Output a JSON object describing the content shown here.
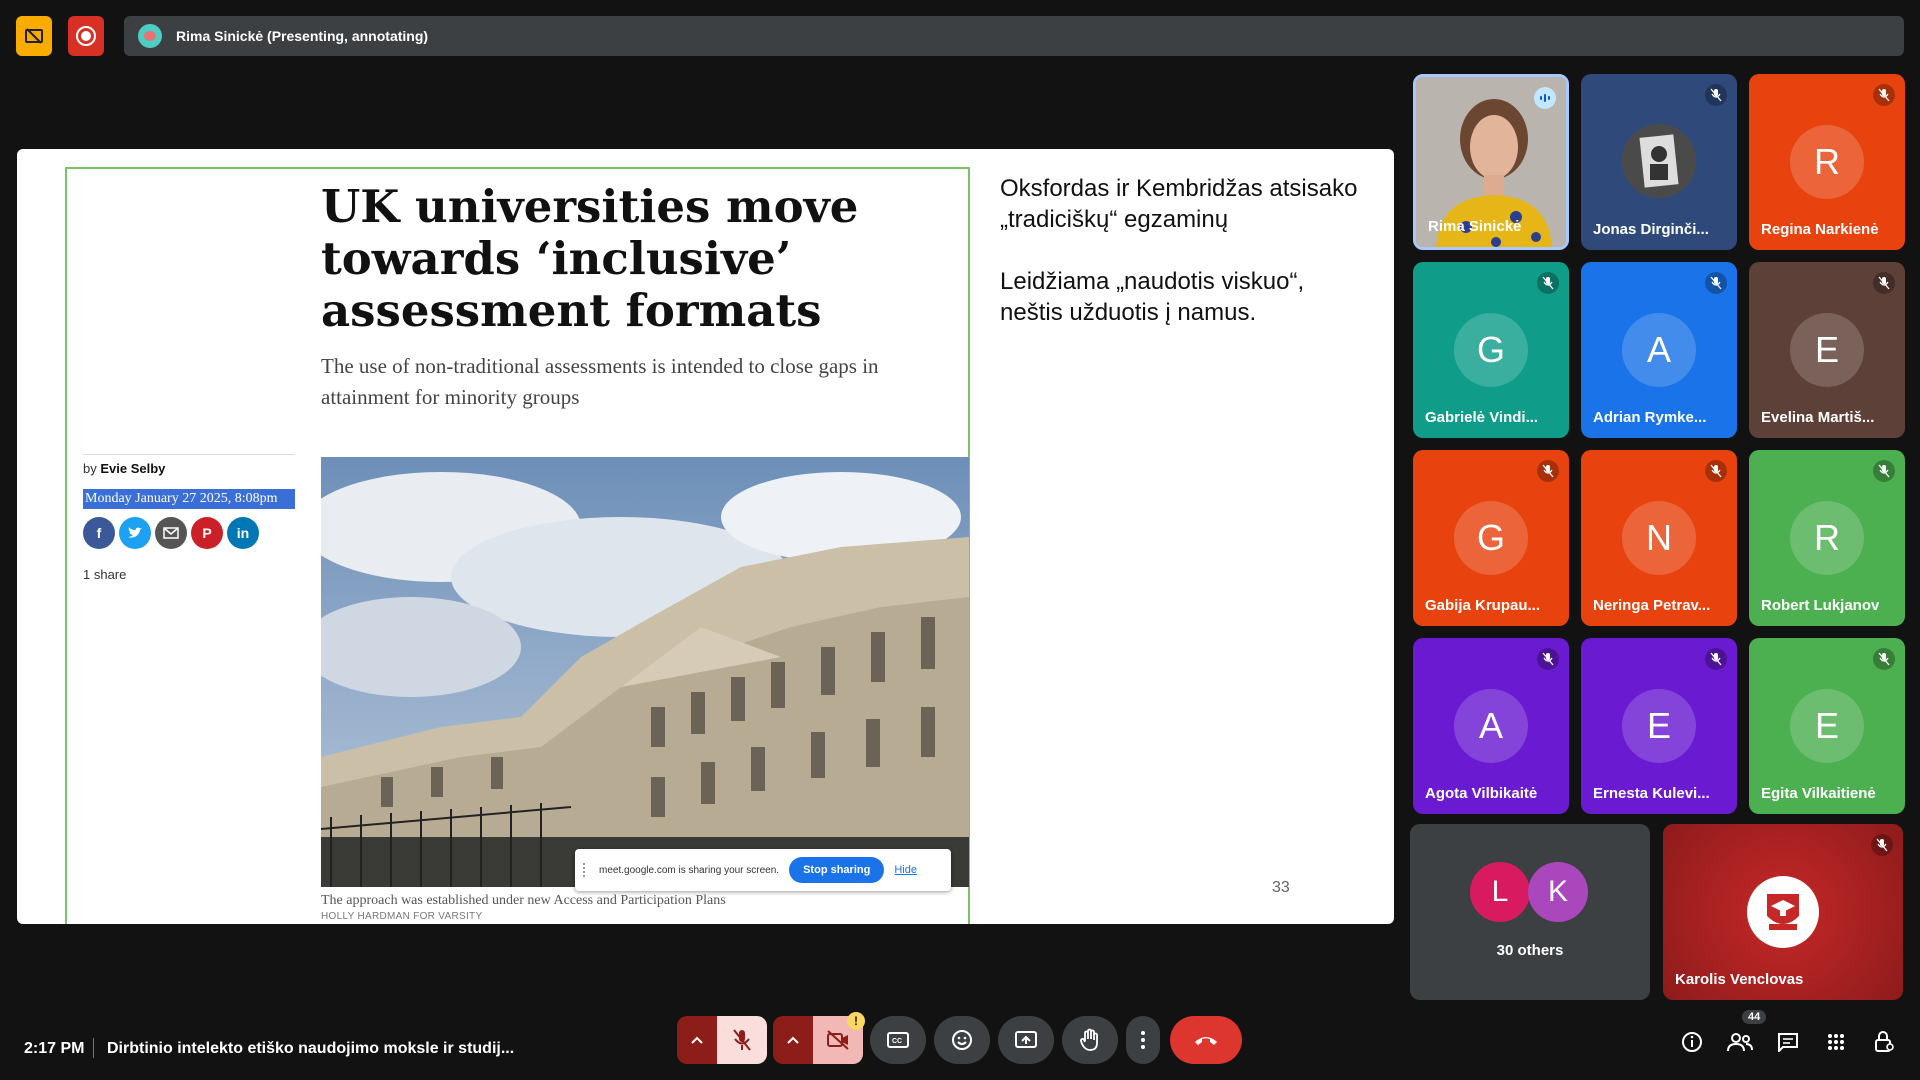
{
  "top": {
    "presenting_banner": "Rima Sinickė (Presenting, annotating)"
  },
  "colors": {
    "meet_yellow": "#f9ab00",
    "record_red": "#d93025",
    "leave_red": "#dc362e",
    "stop_blue": "#1a73e8",
    "highlight_blue": "#3b6fd8"
  },
  "slide": {
    "article_title": "UK universities move towards ‘inclusive’ assessment formats",
    "article_subtitle": "The use of non-traditional assessments is intended to close gaps in attainment for minority groups",
    "byline_prefix": "by ",
    "byline_author": "Evie Selby",
    "date": "Monday January 27 2025, 8:08pm",
    "shares": "1 share",
    "social_icons": [
      "facebook-icon",
      "twitter-icon",
      "email-icon",
      "pinterest-icon",
      "linkedin-icon"
    ],
    "caption": "The approach was established under new Access and Participation Plans",
    "credit": "HOLLY HARDMAN FOR VARSITY",
    "share_bar": {
      "message": "meet.google.com is sharing your screen.",
      "stop_label": "Stop sharing",
      "hide_label": "Hide"
    },
    "text_para1": "Oksfordas ir Kembridžas atsisako „tradiciškų“ egzaminų",
    "text_para2": "Leidžiama „naudotis viskuo“, neštis užduotis į namus.",
    "page_number": "33"
  },
  "participants": [
    {
      "name": "Rima Sinickė",
      "initial": "",
      "color": "#c9a227",
      "video": true,
      "status": "speaking"
    },
    {
      "name": "Jonas Dirginči...",
      "initial": "",
      "color": "#2f4a7a",
      "video": false,
      "status": "muted"
    },
    {
      "name": "Regina Narkienė",
      "initial": "R",
      "color": "#e8430f",
      "video": false,
      "status": "muted"
    },
    {
      "name": "Gabrielė Vindi...",
      "initial": "G",
      "color": "#0f9d8a",
      "video": false,
      "status": "muted"
    },
    {
      "name": "Adrian Rymke...",
      "initial": "A",
      "color": "#1a73e8",
      "video": false,
      "status": "muted"
    },
    {
      "name": "Evelina Martiš...",
      "initial": "E",
      "color": "#5d4037",
      "video": false,
      "status": "muted"
    },
    {
      "name": "Gabija Krupau...",
      "initial": "G",
      "color": "#e8430f",
      "video": false,
      "status": "muted"
    },
    {
      "name": "Neringa Petrav...",
      "initial": "N",
      "color": "#e8430f",
      "video": false,
      "status": "muted"
    },
    {
      "name": "Robert Lukjanov",
      "initial": "R",
      "color": "#4caf50",
      "video": false,
      "status": "muted"
    },
    {
      "name": "Agota Vilbikaitė",
      "initial": "A",
      "color": "#6a1bd1",
      "video": false,
      "status": "muted"
    },
    {
      "name": "Ernesta Kulevi...",
      "initial": "E",
      "color": "#6a1bd1",
      "video": false,
      "status": "muted"
    },
    {
      "name": "Egita Vilkaitienė",
      "initial": "E",
      "color": "#4caf50",
      "video": false,
      "status": "muted"
    }
  ],
  "others": {
    "label": "30 others",
    "avatars": [
      {
        "initial": "L",
        "color": "#d81b60"
      },
      {
        "initial": "K",
        "color": "#ab47bc"
      }
    ]
  },
  "karolis": {
    "name": "Karolis Venclovas",
    "status": "muted"
  },
  "bottom": {
    "time": "2:17 PM",
    "meeting_title": "Dirbtinio intelekto etiško naudojimo moksle ir studij...",
    "participant_count": "44",
    "warn": "!"
  }
}
